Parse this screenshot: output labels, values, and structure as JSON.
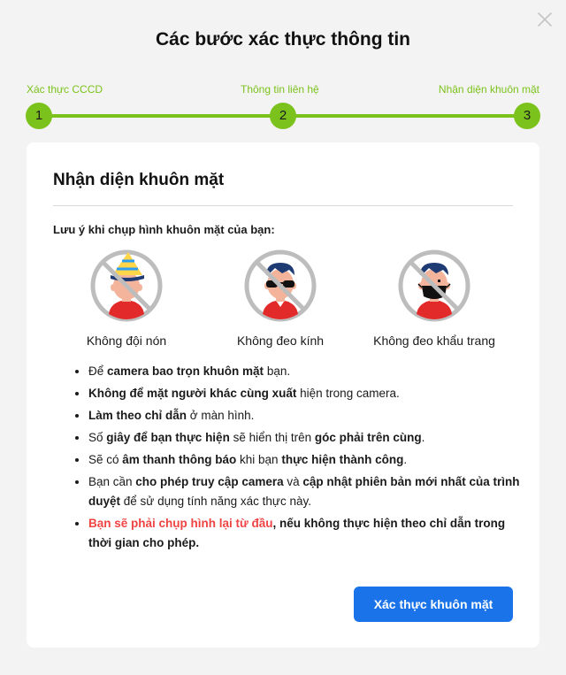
{
  "modal": {
    "title": "Các bước xác thực thông tin",
    "close_icon": "close-icon"
  },
  "steps": [
    {
      "number": "1",
      "label": "Xác thực CCCD"
    },
    {
      "number": "2",
      "label": "Thông tin liên hệ"
    },
    {
      "number": "3",
      "label": "Nhận diện khuôn mặt"
    }
  ],
  "colors": {
    "accent_green": "#7cc21c",
    "primary_blue": "#1a73e8",
    "warning_red": "#ef4444",
    "prohibit_gray": "#bdbdbd"
  },
  "card": {
    "title": "Nhận diện khuôn mặt",
    "note_heading": "Lưu ý khi chụp hình khuôn mặt của bạn:",
    "rules": [
      {
        "icon": "no-hat-icon",
        "caption": "Không đội nón"
      },
      {
        "icon": "no-glasses-icon",
        "caption": "Không đeo kính"
      },
      {
        "icon": "no-mask-icon",
        "caption": "Không đeo khẩu trang"
      }
    ],
    "bullets": [
      [
        {
          "t": "Để "
        },
        {
          "t": "camera bao trọn khuôn mặt",
          "b": true
        },
        {
          "t": " bạn."
        }
      ],
      [
        {
          "t": "Không để mặt người khác cùng xuất",
          "b": true
        },
        {
          "t": " hiện trong camera."
        }
      ],
      [
        {
          "t": "Làm theo chỉ dẫn",
          "b": true
        },
        {
          "t": " ở màn hình."
        }
      ],
      [
        {
          "t": "Số "
        },
        {
          "t": "giây để bạn thực hiện",
          "b": true
        },
        {
          "t": " sẽ hiển thị trên "
        },
        {
          "t": "góc phải trên cùng",
          "b": true
        },
        {
          "t": "."
        }
      ],
      [
        {
          "t": "Sẽ có "
        },
        {
          "t": "âm thanh thông báo",
          "b": true
        },
        {
          "t": " khi bạn "
        },
        {
          "t": "thực hiện thành công",
          "b": true
        },
        {
          "t": "."
        }
      ],
      [
        {
          "t": "Bạn cần "
        },
        {
          "t": "cho phép truy cập camera",
          "b": true
        },
        {
          "t": " và "
        },
        {
          "t": "cập nhật phiên bản mới nhất của trình duyệt",
          "b": true
        },
        {
          "t": " để sử dụng tính năng xác thực này."
        }
      ],
      [
        {
          "t": "Bạn sẽ phải chụp hình lại từ đầu",
          "b": true,
          "warn": true
        },
        {
          "t": ", nếu không thực hiện theo chỉ dẫn trong thời gian cho phép.",
          "b": true
        }
      ]
    ],
    "button_label": "Xác thực khuôn mặt"
  }
}
